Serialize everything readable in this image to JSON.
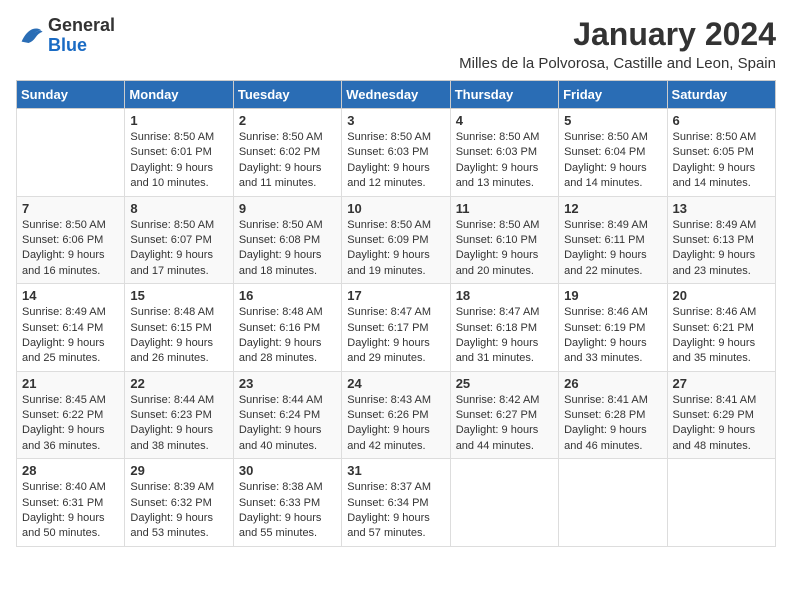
{
  "header": {
    "logo_general": "General",
    "logo_blue": "Blue",
    "month_title": "January 2024",
    "location": "Milles de la Polvorosa, Castille and Leon, Spain"
  },
  "weekdays": [
    "Sunday",
    "Monday",
    "Tuesday",
    "Wednesday",
    "Thursday",
    "Friday",
    "Saturday"
  ],
  "weeks": [
    [
      {
        "day": "",
        "info": ""
      },
      {
        "day": "1",
        "info": "Sunrise: 8:50 AM\nSunset: 6:01 PM\nDaylight: 9 hours\nand 10 minutes."
      },
      {
        "day": "2",
        "info": "Sunrise: 8:50 AM\nSunset: 6:02 PM\nDaylight: 9 hours\nand 11 minutes."
      },
      {
        "day": "3",
        "info": "Sunrise: 8:50 AM\nSunset: 6:03 PM\nDaylight: 9 hours\nand 12 minutes."
      },
      {
        "day": "4",
        "info": "Sunrise: 8:50 AM\nSunset: 6:03 PM\nDaylight: 9 hours\nand 13 minutes."
      },
      {
        "day": "5",
        "info": "Sunrise: 8:50 AM\nSunset: 6:04 PM\nDaylight: 9 hours\nand 14 minutes."
      },
      {
        "day": "6",
        "info": "Sunrise: 8:50 AM\nSunset: 6:05 PM\nDaylight: 9 hours\nand 14 minutes."
      }
    ],
    [
      {
        "day": "7",
        "info": "Sunrise: 8:50 AM\nSunset: 6:06 PM\nDaylight: 9 hours\nand 16 minutes."
      },
      {
        "day": "8",
        "info": "Sunrise: 8:50 AM\nSunset: 6:07 PM\nDaylight: 9 hours\nand 17 minutes."
      },
      {
        "day": "9",
        "info": "Sunrise: 8:50 AM\nSunset: 6:08 PM\nDaylight: 9 hours\nand 18 minutes."
      },
      {
        "day": "10",
        "info": "Sunrise: 8:50 AM\nSunset: 6:09 PM\nDaylight: 9 hours\nand 19 minutes."
      },
      {
        "day": "11",
        "info": "Sunrise: 8:50 AM\nSunset: 6:10 PM\nDaylight: 9 hours\nand 20 minutes."
      },
      {
        "day": "12",
        "info": "Sunrise: 8:49 AM\nSunset: 6:11 PM\nDaylight: 9 hours\nand 22 minutes."
      },
      {
        "day": "13",
        "info": "Sunrise: 8:49 AM\nSunset: 6:13 PM\nDaylight: 9 hours\nand 23 minutes."
      }
    ],
    [
      {
        "day": "14",
        "info": "Sunrise: 8:49 AM\nSunset: 6:14 PM\nDaylight: 9 hours\nand 25 minutes."
      },
      {
        "day": "15",
        "info": "Sunrise: 8:48 AM\nSunset: 6:15 PM\nDaylight: 9 hours\nand 26 minutes."
      },
      {
        "day": "16",
        "info": "Sunrise: 8:48 AM\nSunset: 6:16 PM\nDaylight: 9 hours\nand 28 minutes."
      },
      {
        "day": "17",
        "info": "Sunrise: 8:47 AM\nSunset: 6:17 PM\nDaylight: 9 hours\nand 29 minutes."
      },
      {
        "day": "18",
        "info": "Sunrise: 8:47 AM\nSunset: 6:18 PM\nDaylight: 9 hours\nand 31 minutes."
      },
      {
        "day": "19",
        "info": "Sunrise: 8:46 AM\nSunset: 6:19 PM\nDaylight: 9 hours\nand 33 minutes."
      },
      {
        "day": "20",
        "info": "Sunrise: 8:46 AM\nSunset: 6:21 PM\nDaylight: 9 hours\nand 35 minutes."
      }
    ],
    [
      {
        "day": "21",
        "info": "Sunrise: 8:45 AM\nSunset: 6:22 PM\nDaylight: 9 hours\nand 36 minutes."
      },
      {
        "day": "22",
        "info": "Sunrise: 8:44 AM\nSunset: 6:23 PM\nDaylight: 9 hours\nand 38 minutes."
      },
      {
        "day": "23",
        "info": "Sunrise: 8:44 AM\nSunset: 6:24 PM\nDaylight: 9 hours\nand 40 minutes."
      },
      {
        "day": "24",
        "info": "Sunrise: 8:43 AM\nSunset: 6:26 PM\nDaylight: 9 hours\nand 42 minutes."
      },
      {
        "day": "25",
        "info": "Sunrise: 8:42 AM\nSunset: 6:27 PM\nDaylight: 9 hours\nand 44 minutes."
      },
      {
        "day": "26",
        "info": "Sunrise: 8:41 AM\nSunset: 6:28 PM\nDaylight: 9 hours\nand 46 minutes."
      },
      {
        "day": "27",
        "info": "Sunrise: 8:41 AM\nSunset: 6:29 PM\nDaylight: 9 hours\nand 48 minutes."
      }
    ],
    [
      {
        "day": "28",
        "info": "Sunrise: 8:40 AM\nSunset: 6:31 PM\nDaylight: 9 hours\nand 50 minutes."
      },
      {
        "day": "29",
        "info": "Sunrise: 8:39 AM\nSunset: 6:32 PM\nDaylight: 9 hours\nand 53 minutes."
      },
      {
        "day": "30",
        "info": "Sunrise: 8:38 AM\nSunset: 6:33 PM\nDaylight: 9 hours\nand 55 minutes."
      },
      {
        "day": "31",
        "info": "Sunrise: 8:37 AM\nSunset: 6:34 PM\nDaylight: 9 hours\nand 57 minutes."
      },
      {
        "day": "",
        "info": ""
      },
      {
        "day": "",
        "info": ""
      },
      {
        "day": "",
        "info": ""
      }
    ]
  ]
}
